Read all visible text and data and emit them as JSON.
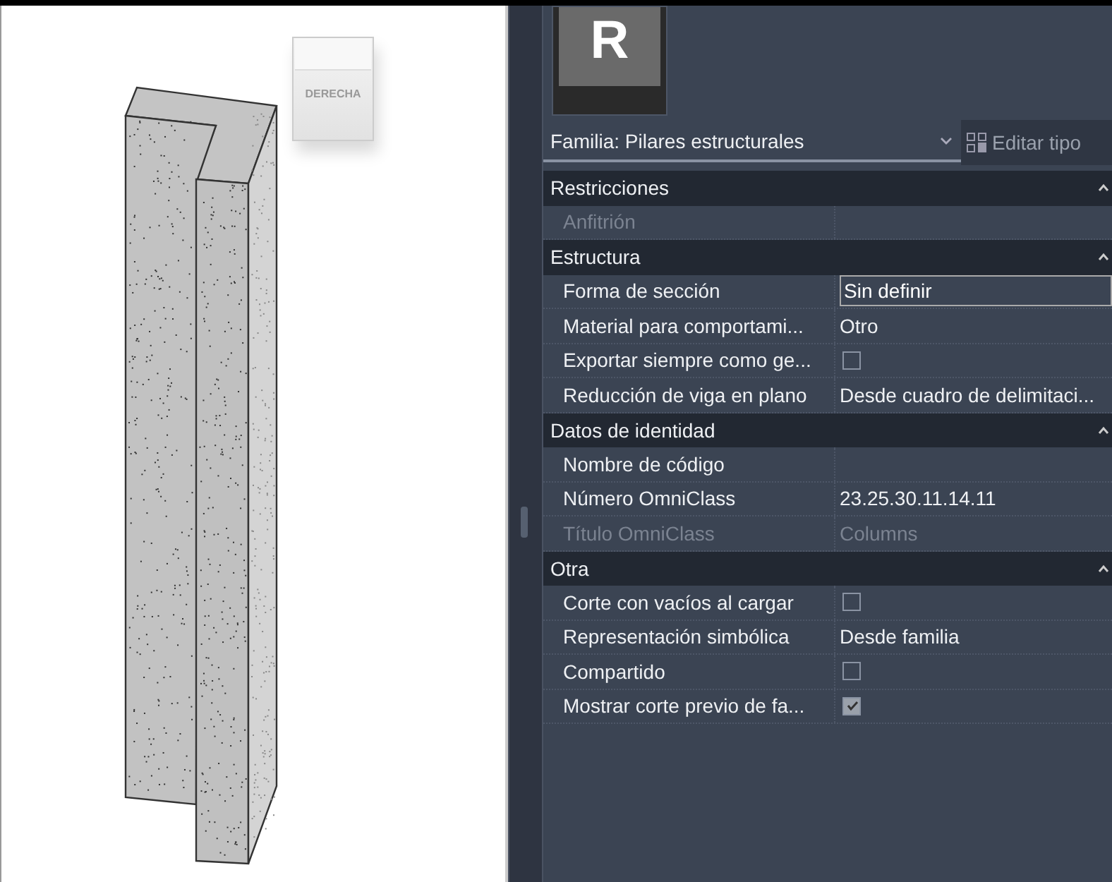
{
  "viewport": {
    "view_cube": {
      "label": "DERECHA"
    }
  },
  "properties": {
    "logo": "R",
    "family_selector": {
      "value": "Familia: Pilares estructurales"
    },
    "edit_type_button": {
      "label": "Editar tipo"
    },
    "groups": [
      {
        "title": "Restricciones",
        "expanded": true,
        "rows": [
          {
            "label": "Anfitrión",
            "kind": "text",
            "disabled": true
          }
        ]
      },
      {
        "title": "Estructura",
        "expanded": true,
        "rows": [
          {
            "label": "Forma de sección",
            "kind": "field",
            "value": "Sin definir",
            "disabled": false
          },
          {
            "label": "Material para comportami...",
            "kind": "text",
            "value": "Otro",
            "disabled": false
          },
          {
            "label": "Exportar siempre como ge...",
            "kind": "checkbox",
            "checked": false,
            "disabled": false
          },
          {
            "label": "Reducción de viga en plano",
            "kind": "text",
            "value": "Desde cuadro de delimitaci...",
            "disabled": false
          }
        ]
      },
      {
        "title": "Datos de identidad",
        "expanded": true,
        "rows": [
          {
            "label": "Nombre de código",
            "kind": "text",
            "disabled": false
          },
          {
            "label": "Número OmniClass",
            "kind": "text",
            "value": "23.25.30.11.14.11",
            "disabled": false
          },
          {
            "label": "Título OmniClass",
            "kind": "text",
            "value": "Columns",
            "disabled": true
          }
        ]
      },
      {
        "title": "Otra",
        "expanded": true,
        "rows": [
          {
            "label": "Corte con vacíos al cargar",
            "kind": "checkbox",
            "checked": false,
            "disabled": false
          },
          {
            "label": "Representación simbólica",
            "kind": "text",
            "value": "Desde familia",
            "disabled": false
          },
          {
            "label": "Compartido",
            "kind": "checkbox",
            "checked": false,
            "disabled": false
          },
          {
            "label": "Mostrar corte previo de fa...",
            "kind": "checkbox",
            "checked": true,
            "disabled": false
          }
        ]
      }
    ]
  }
}
